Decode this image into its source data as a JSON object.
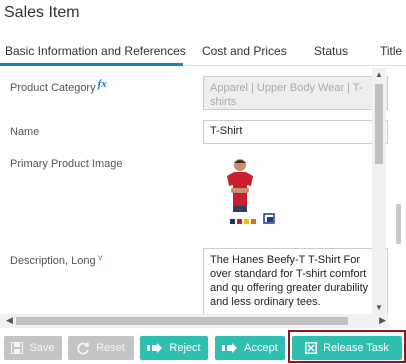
{
  "window": {
    "title": "Sales Item"
  },
  "tabs": [
    {
      "label": "Basic Information and References",
      "active": true
    },
    {
      "label": "Cost and Prices"
    },
    {
      "label": "Status"
    },
    {
      "label": "Title"
    }
  ],
  "fields": {
    "product_category": {
      "label": "Product Category",
      "badge": "fx",
      "value": "Apparel | Upper Body Wear | T-shirts"
    },
    "name": {
      "label": "Name",
      "value": "T-Shirt"
    },
    "primary_image": {
      "label": "Primary Product Image"
    },
    "description": {
      "label": "Description, Long",
      "value": "The Hanes Beefy-T T-Shirt For over standard for T-shirt comfort and qu offering greater durability and less ordinary tees."
    }
  },
  "buttons": {
    "save": "Save",
    "reset": "Reset",
    "reject": "Reject",
    "accept": "Accept",
    "release_task": "Release Task"
  },
  "icons": [
    "fx-badge-icon",
    "chevron-down-icon",
    "save-icon",
    "reset-icon",
    "reject-icon",
    "accept-icon",
    "release-task-icon"
  ],
  "colors": {
    "accent": "#1a7fc4",
    "button_teal": "#2ebfb1",
    "button_disabled": "#c4c4c4",
    "highlight_outline": "#8b1a1a"
  }
}
